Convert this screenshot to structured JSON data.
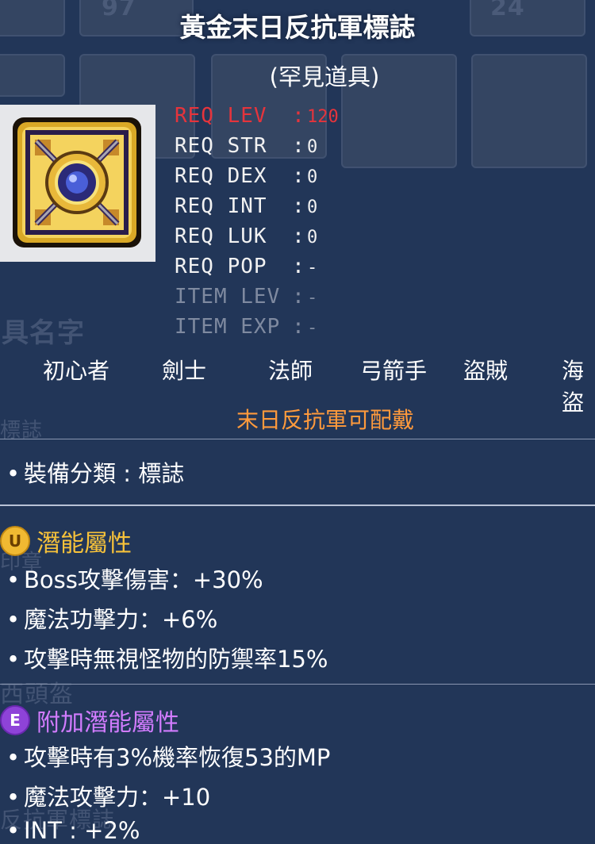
{
  "item": {
    "name": "黃金末日反抗軍標誌",
    "rarity": "(罕見道具)"
  },
  "requirements": [
    {
      "label": "REQ LEV",
      "value": "120"
    },
    {
      "label": "REQ STR",
      "value": "0"
    },
    {
      "label": "REQ DEX",
      "value": "0"
    },
    {
      "label": "REQ INT",
      "value": "0"
    },
    {
      "label": "REQ LUK",
      "value": "0"
    },
    {
      "label": "REQ POP",
      "value": "-"
    },
    {
      "label": "ITEM LEV",
      "value": "-"
    },
    {
      "label": "ITEM EXP",
      "value": "-"
    }
  ],
  "colon": ":",
  "jobs": [
    "初心者",
    "劍士",
    "法師",
    "弓箭手",
    "盜賊",
    "海盜"
  ],
  "allowed_text": "末日反抗軍可配戴",
  "category_line": "裝備分類 : 標誌",
  "bullet": "•",
  "potential": {
    "badge": "U",
    "title": "潛能屬性",
    "lines": [
      "Boss攻擊傷害：+30%",
      "魔法功擊力：+6%",
      "攻擊時無視怪物的防禦率15%"
    ]
  },
  "bonus_potential": {
    "badge": "E",
    "title": "附加潛能屬性",
    "lines": [
      "攻擊時有3%機率恢復53的MP",
      "魔法攻擊力：+10",
      "INT : +2%"
    ]
  },
  "background_text": {
    "top_counter_left": "97",
    "top_counter_right": "24",
    "item_name_header": "具名字",
    "label_1": "標誌",
    "label_2": "印章",
    "label_3": "西頭盔",
    "label_4": "反抗軍標誌"
  },
  "colors": {
    "background": "#223658",
    "req_unmet": "#e5343c",
    "req_met": "#f2f2f2",
    "req_inactive": "#7f8aa0",
    "allowed": "#ff9a3c",
    "potential_title": "#f7c23a",
    "bonus_title": "#d27cff"
  }
}
